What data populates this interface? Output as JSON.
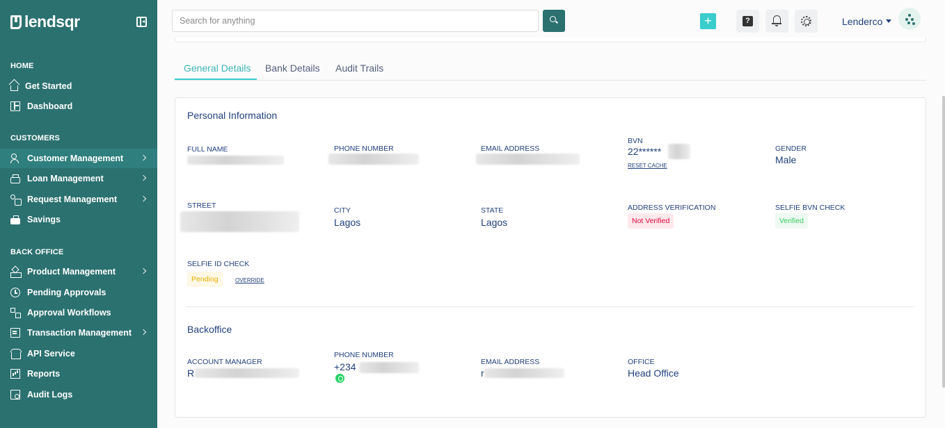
{
  "brand": {
    "name": "lendsqr"
  },
  "sidebar": {
    "sections": [
      "HOME",
      "CUSTOMERS",
      "BACK OFFICE"
    ],
    "items": [
      {
        "label": "Get Started"
      },
      {
        "label": "Dashboard"
      },
      {
        "label": "Customer Management"
      },
      {
        "label": "Loan Management"
      },
      {
        "label": "Request Management"
      },
      {
        "label": "Savings"
      },
      {
        "label": "Product Management"
      },
      {
        "label": "Pending Approvals"
      },
      {
        "label": "Approval Workflows"
      },
      {
        "label": "Transaction Management"
      },
      {
        "label": "API Service"
      },
      {
        "label": "Reports"
      },
      {
        "label": "Audit Logs"
      }
    ]
  },
  "header": {
    "search_placeholder": "Search for anything",
    "plus_label": "+",
    "help_label": "?",
    "user_name": "Lenderco"
  },
  "tabs": [
    "General Details",
    "Bank Details",
    "Audit Trails"
  ],
  "personal": {
    "title": "Personal Information",
    "full_name_label": "FULL NAME",
    "phone_label": "PHONE NUMBER",
    "email_label": "EMAIL ADDRESS",
    "bvn_label": "BVN",
    "bvn_value": "22******",
    "reset_cache": "RESET CACHE",
    "gender_label": "GENDER",
    "gender_value": "Male",
    "street_label": "STREET",
    "city_label": "CITY",
    "city_value": "Lagos",
    "state_label": "STATE",
    "state_value": "Lagos",
    "address_verification_label": "ADDRESS VERIFICATION",
    "address_verification_status": "Not Verified",
    "selfie_bvn_label": "SELFIE BVN CHECK",
    "selfie_bvn_status": "Verified",
    "selfie_id_label": "SELFIE ID CHECK",
    "selfie_id_status": "Pending",
    "override": "OVERRIDE"
  },
  "backoffice": {
    "title": "Backoffice",
    "account_manager_label": "ACCOUNT MANAGER",
    "account_manager_value": "R",
    "phone_label": "PHONE NUMBER",
    "phone_value": "+234",
    "email_label": "EMAIL ADDRESS",
    "email_value": "r",
    "office_label": "OFFICE",
    "office_value": "Head Office"
  },
  "colors": {
    "sidebar": "#2b7170",
    "accent": "#39cdcc",
    "text": "#213f7d",
    "danger": "#e4033b",
    "success": "#39cd62",
    "warning": "#e9b200"
  }
}
